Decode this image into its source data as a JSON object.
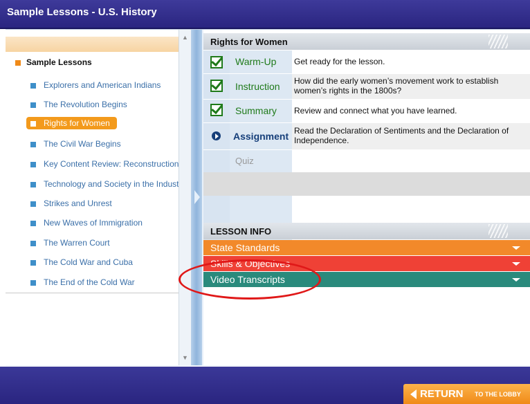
{
  "window": {
    "title": "Sample Lessons - U.S. History"
  },
  "sidebar": {
    "root_label": "Sample Lessons",
    "items": [
      {
        "label": "Explorers and American Indians",
        "active": false
      },
      {
        "label": "The Revolution Begins",
        "active": false
      },
      {
        "label": "Rights for Women",
        "active": true
      },
      {
        "label": "The Civil War Begins",
        "active": false
      },
      {
        "label": "Key Content Review: Reconstruction",
        "active": false
      },
      {
        "label": "Technology and Society in the Industrial Age",
        "active": false
      },
      {
        "label": "Strikes and Unrest",
        "active": false
      },
      {
        "label": "New Waves of Immigration",
        "active": false
      },
      {
        "label": "The Warren Court",
        "active": false
      },
      {
        "label": "The Cold War and Cuba",
        "active": false
      },
      {
        "label": "The End of the Cold War",
        "active": false
      }
    ]
  },
  "lesson": {
    "title": "Rights for Women",
    "steps": [
      {
        "icon": "check-icon",
        "label": "Warm-Up",
        "description": "Get ready for the lesson."
      },
      {
        "icon": "check-icon",
        "label": "Instruction",
        "description": "How did the early women’s movement work to establish women’s rights in the 1800s?"
      },
      {
        "icon": "check-icon",
        "label": "Summary",
        "description": "Review and connect what you have learned."
      },
      {
        "icon": "play-icon",
        "label": "Assignment",
        "description": "Read the Declaration of Sentiments and the Declaration of Independence."
      },
      {
        "icon": "",
        "label": "Quiz",
        "description": ""
      }
    ]
  },
  "lesson_info": {
    "header": "LESSON INFO",
    "sections": [
      {
        "label": "State Standards",
        "color": "#f2892a"
      },
      {
        "label": "Skills & Objectives",
        "color": "#ef4136"
      },
      {
        "label": "Video Transcripts",
        "color": "#2a8a7c"
      }
    ]
  },
  "footer": {
    "return_label": "RETURN",
    "return_sub": "TO THE LOBBY"
  },
  "colors": {
    "title_bar": "#2f2a8a",
    "accent_orange": "#f39a1c",
    "completed_green": "#1f7a1a",
    "highlight_circle": "#e01818"
  }
}
